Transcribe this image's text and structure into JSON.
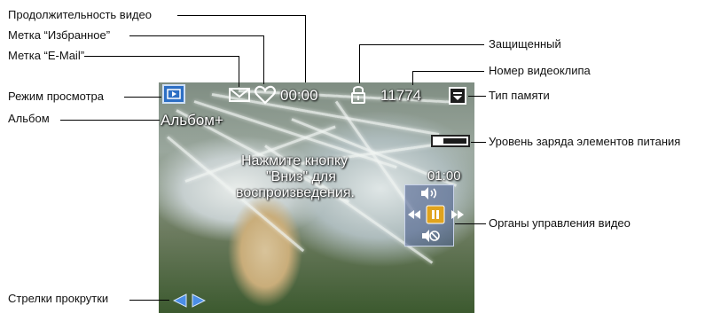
{
  "callouts": {
    "video_duration": "Продолжительность видео",
    "favorite_tag": "Метка “Избранное”",
    "email_tag": "Метка “E-Mail”",
    "review_mode": "Режим просмотра",
    "album": "Альбом",
    "protected": "Защищенный",
    "clip_number": "Номер видеоклипа",
    "memory_type": "Тип памяти",
    "battery_level": "Уровень заряда элементов питания",
    "video_controls": "Органы управления видео",
    "scroll_arrows": "Стрелки прокрутки"
  },
  "screen": {
    "album_name": "Альбом+",
    "elapsed_time": "00:00",
    "clip_number": "11774",
    "total_duration": "01:00",
    "hint_line1": "Нажмите кнопку",
    "hint_line2": "\"Вниз\" для",
    "hint_line3": "воспроизведения."
  },
  "icons": {
    "review_mode": "review-mode-icon",
    "email": "envelope-icon",
    "favorite": "heart-icon",
    "protected": "lock-icon",
    "memory": "memory-card-icon",
    "battery": "battery-icon",
    "volume_up": "volume-up-icon",
    "rewind": "rewind-icon",
    "pause": "pause-icon",
    "fast_forward": "fast-forward-icon",
    "mute": "mute-icon",
    "arrow_left": "arrow-left-icon",
    "arrow_right": "arrow-right-icon"
  },
  "colors": {
    "mode_icon": "#2d6fc4",
    "arrow": "#4b8ee6",
    "pause_button": "#e0a31e",
    "controls_panel": "#465a8c"
  }
}
